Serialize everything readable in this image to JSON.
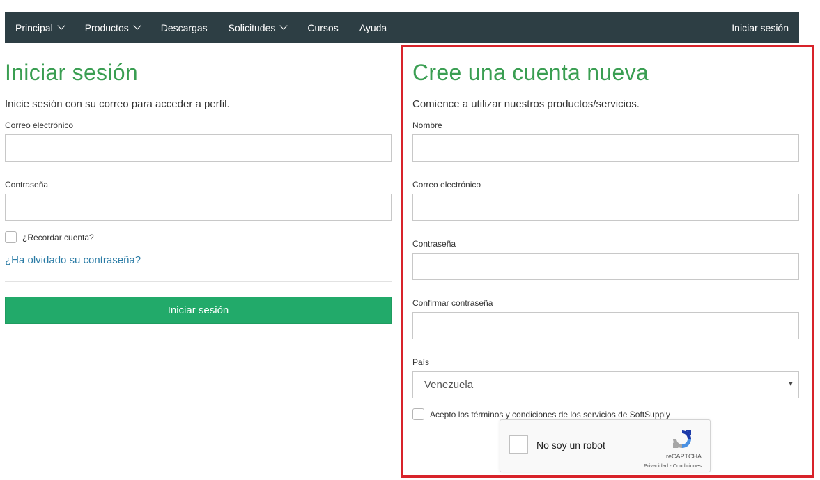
{
  "nav": {
    "items": [
      {
        "label": "Principal",
        "dropdown": true
      },
      {
        "label": "Productos",
        "dropdown": true
      },
      {
        "label": "Descargas",
        "dropdown": false
      },
      {
        "label": "Solicitudes",
        "dropdown": true
      },
      {
        "label": "Cursos",
        "dropdown": false
      },
      {
        "label": "Ayuda",
        "dropdown": false
      }
    ],
    "login_link": "Iniciar sesión"
  },
  "login": {
    "title": "Iniciar sesión",
    "subtitle": "Inicie sesión con su correo para acceder a perfil.",
    "email_label": "Correo electrónico",
    "email_value": "",
    "password_label": "Contraseña",
    "password_value": "",
    "remember_label": "¿Recordar cuenta?",
    "forgot_link": "¿Ha olvidado su contraseña?",
    "submit_label": "Iniciar sesión"
  },
  "register": {
    "title": "Cree una cuenta nueva",
    "subtitle": "Comience a utilizar nuestros productos/servicios.",
    "name_label": "Nombre",
    "name_value": "",
    "email_label": "Correo electrónico",
    "email_value": "",
    "password_label": "Contraseña",
    "password_value": "",
    "confirm_label": "Confirmar contraseña",
    "confirm_value": "",
    "country_label": "País",
    "country_value": "Venezuela",
    "terms_label": "Acepto los términos y condiciones de los servicios de SoftSupply"
  },
  "recaptcha": {
    "text": "No soy un robot",
    "brand": "reCAPTCHA",
    "links": "Privacidad - Condiciones"
  },
  "colors": {
    "navbar": "#2d3e44",
    "title_green": "#3a9e52",
    "button_green": "#22aa6a",
    "link_blue": "#2a7ba5",
    "highlight_red": "#d8232a"
  }
}
